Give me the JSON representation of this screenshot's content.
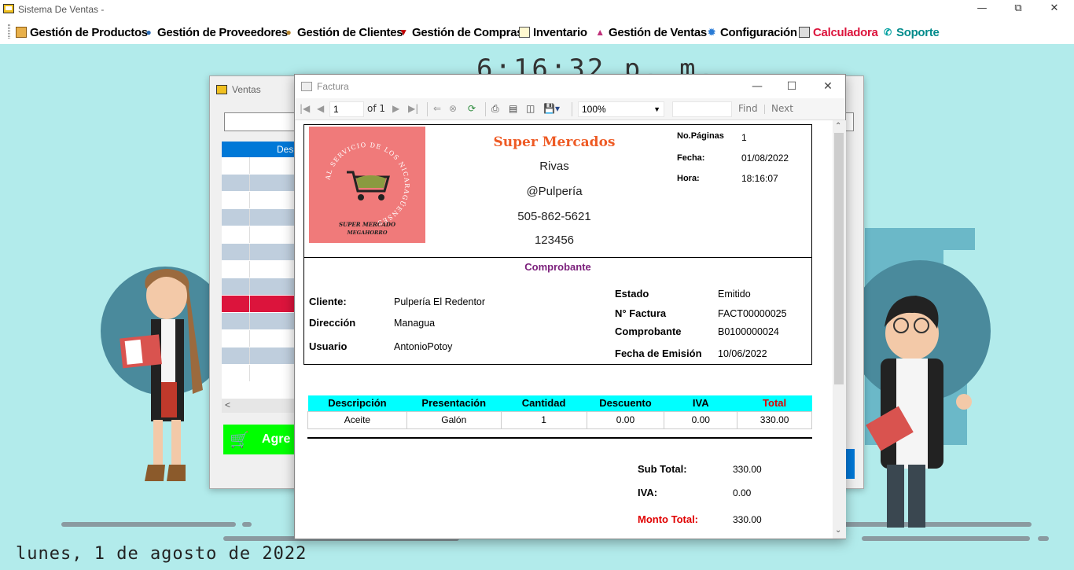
{
  "window": {
    "title": "Sistema De Ventas -"
  },
  "menu": [
    {
      "label": "Gestión de Productos",
      "icon": "box-icon"
    },
    {
      "label": "Gestión de Proveedores",
      "icon": "person-icon"
    },
    {
      "label": "Gestión de Clientes",
      "icon": "person-icon"
    },
    {
      "label": "Gestión de Compras",
      "icon": "cart-icon"
    },
    {
      "label": "Inventario",
      "icon": "clipboard-icon"
    },
    {
      "label": "Gestión de Ventas",
      "icon": "chart-icon"
    },
    {
      "label": "Configuración",
      "icon": "gear-icon"
    },
    {
      "label": "Calculadora",
      "icon": "calculator-icon"
    },
    {
      "label": "Soporte",
      "icon": "phone-icon"
    }
  ],
  "colors": {
    "calculadora": "#dc143c",
    "soporte": "#008b8b",
    "cyan_header": "#00ffff",
    "store_name": "#ee5a24"
  },
  "clock": "6:16:32 p. m.",
  "date": "lunes, 1 de agosto de 2022",
  "ventas": {
    "title": "Ventas",
    "column": "Des",
    "agregar": "Agre"
  },
  "factura": {
    "title": "Factura",
    "toolbar": {
      "page": "1",
      "of_label": "of 1",
      "zoom": "100%",
      "find": "Find",
      "next": "Next"
    },
    "logo": {
      "circle_text": "AL SERVICIO DE LOS NICARAGÜENSES",
      "line1": "SUPER MERCADO",
      "line2": "MEGAHORRO"
    },
    "store": {
      "name": "Super Mercados",
      "city": "Rivas",
      "handle": "@Pulpería",
      "phone": "505-862-5621",
      "code": "123456"
    },
    "meta": {
      "pages_label": "No.Páginas",
      "pages": "1",
      "fecha_label": "Fecha:",
      "fecha": "01/08/2022",
      "hora_label": "Hora:",
      "hora": "18:16:07"
    },
    "comprobante_title": "Comprobante",
    "client": {
      "cliente_label": "Cliente:",
      "cliente": "Pulpería El Redentor",
      "direccion_label": "Dirección",
      "direccion": "Managua",
      "usuario_label": "Usuario",
      "usuario": "AntonioPotoy",
      "estado_label": "Estado",
      "estado": "Emitido",
      "factura_label": "N° Factura",
      "factura": "FACT00000025",
      "comprobante_label": "Comprobante",
      "comprobante": "B0100000024",
      "emision_label": "Fecha de Emisión",
      "emision": "10/06/2022"
    },
    "table": {
      "headers": [
        "Descripción",
        "Presentación",
        "Cantidad",
        "Descuento",
        "IVA",
        "Total"
      ],
      "rows": [
        [
          "Aceite",
          "Galón",
          "1",
          "0.00",
          "0.00",
          "330.00"
        ]
      ]
    },
    "summary": {
      "subtotal_label": "Sub Total:",
      "subtotal": "330.00",
      "iva_label": "IVA:",
      "iva": "0.00",
      "monto_label": "Monto Total:",
      "monto": "330.00"
    }
  }
}
